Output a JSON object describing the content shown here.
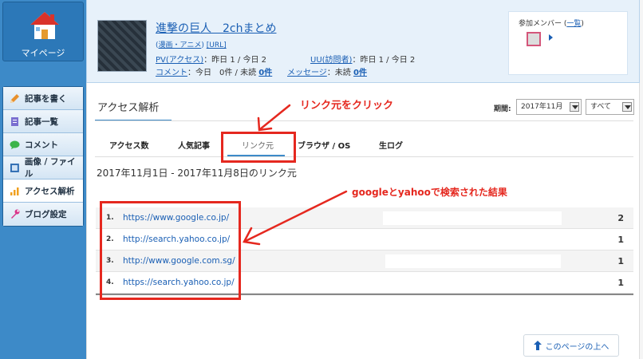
{
  "sidebar": {
    "mypage_label": "マイページ",
    "items": [
      {
        "label": "記事を書く",
        "icon": "pencil-icon"
      },
      {
        "label": "記事一覧",
        "icon": "document-list-icon"
      },
      {
        "label": "コメント",
        "icon": "comment-bubble-icon"
      },
      {
        "label": "画像 / ファイル",
        "icon": "image-file-icon"
      },
      {
        "label": "アクセス解析",
        "icon": "bar-chart-icon"
      },
      {
        "label": "ブログ設定",
        "icon": "wrench-icon"
      }
    ]
  },
  "blog": {
    "title": "進撃の巨人　2chまとめ",
    "category_prefix": "(",
    "category": "漫画・アニメ",
    "category_suffix": ")",
    "url_link": "[URL]",
    "pv_label": "PV(アクセス)",
    "pv_text": "：昨日 1 / 今日 2",
    "uu_label": "UU(訪問者)",
    "uu_text": "：昨日 1 / 今日 2",
    "comment_label": "コメント",
    "comment_text": "：今日　0件 / 未読",
    "comment_unread": "0件",
    "message_label": "メッセージ",
    "message_text": "：未読",
    "message_unread": "0件"
  },
  "members": {
    "label_prefix": "参加メンバー (",
    "link": "一覧",
    "label_suffix": ")"
  },
  "main": {
    "page_title": "アクセス解析",
    "period_label": "期間:",
    "period_value": "2017年11月",
    "type_value": "すべて",
    "tabs": [
      "アクセス数",
      "人気記事",
      "リンク元",
      "ブラウザ / OS",
      "生ログ"
    ],
    "date_range": "2017年11月1日 - 2017年11月8日のリンク元",
    "referrers": [
      {
        "rank": "1.",
        "url": "https://www.google.co.jp/",
        "count": "2"
      },
      {
        "rank": "2.",
        "url": "http://search.yahoo.co.jp/",
        "count": "1"
      },
      {
        "rank": "3.",
        "url": "http://www.google.com.sg/",
        "count": "1"
      },
      {
        "rank": "4.",
        "url": "https://search.yahoo.co.jp/",
        "count": "1"
      }
    ],
    "to_top": "このページの上へ"
  },
  "annotations": {
    "click_note": "リンク元をクリック",
    "result_note": "googleとyahooで検索された結果",
    "color": "#e5281f"
  }
}
